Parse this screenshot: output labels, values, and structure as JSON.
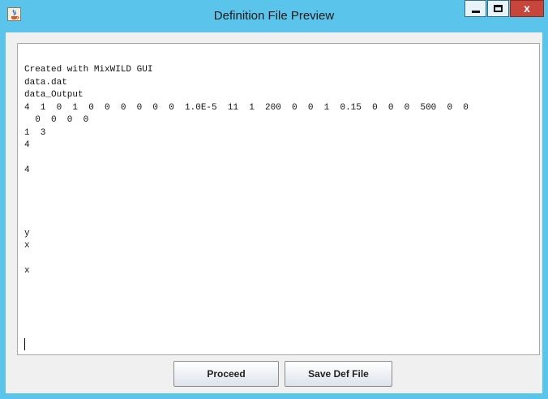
{
  "window": {
    "title": "Definition File Preview",
    "close_label": "x"
  },
  "editor": {
    "content": "Created with MixWILD GUI\ndata.dat\ndata_Output\n4  1  0  1  0  0  0  0  0  0  1.0E-5  11  1  200  0  0  1  0.15  0  0  0  500  0  0\n  0  0  0  0\n1  3\n4\n\n4\n\n\n\n\ny\nx\n\nx"
  },
  "buttons": {
    "proceed_label": "Proceed",
    "save_label": "Save Def File"
  }
}
